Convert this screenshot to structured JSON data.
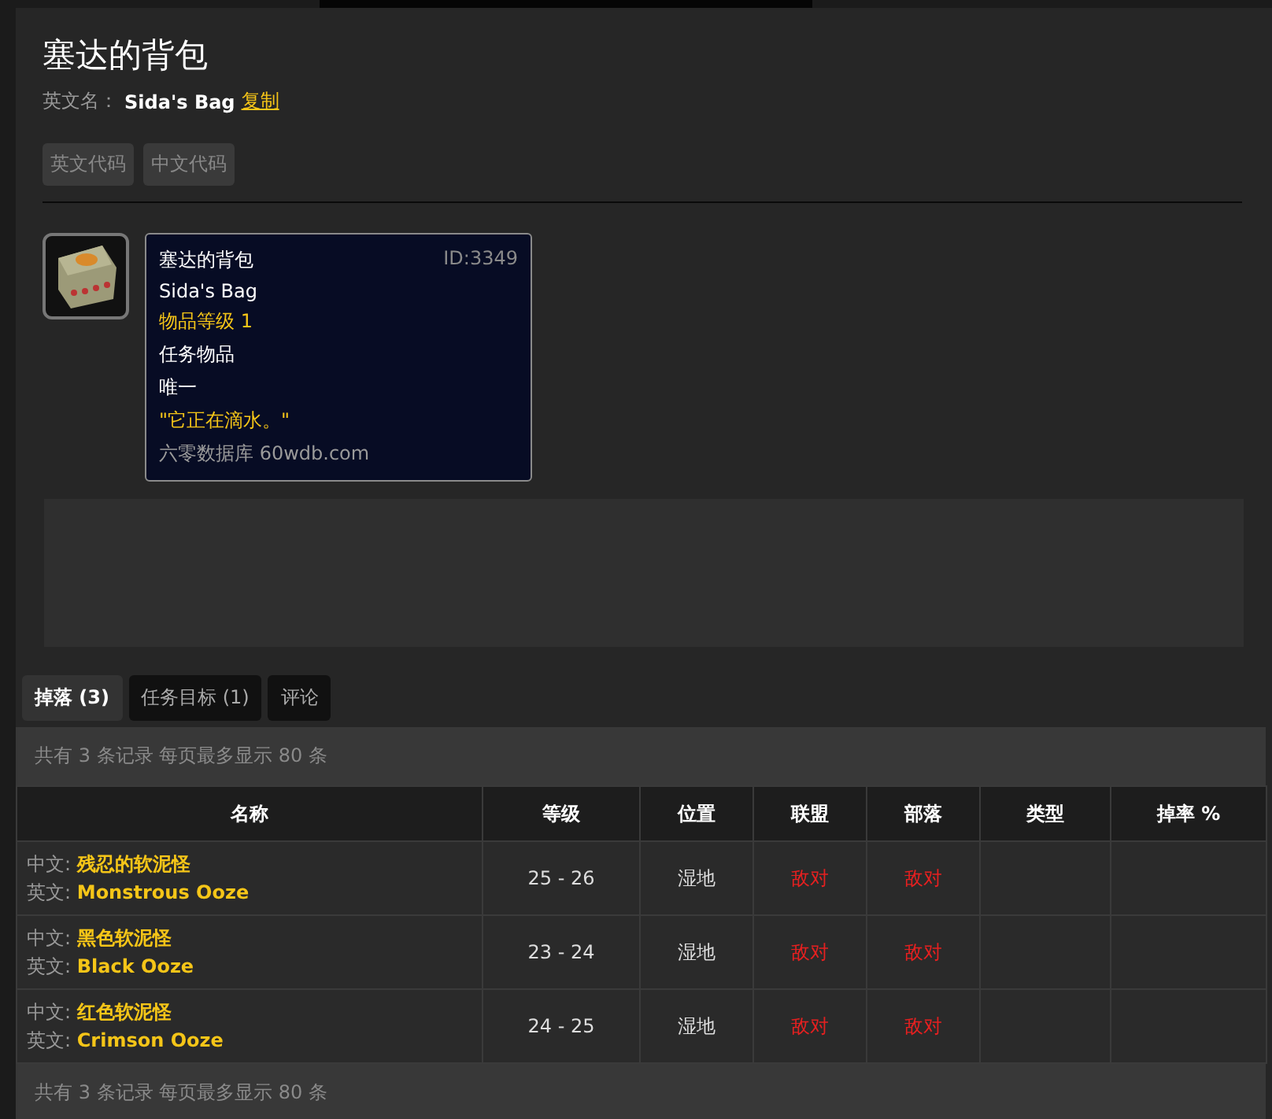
{
  "title": "塞达的背包",
  "english_name": {
    "label": "英文名：",
    "value": "Sida's Bag",
    "copy_link": "复制"
  },
  "code_buttons": [
    "英文代码",
    "中文代码"
  ],
  "tooltip": {
    "name": "塞达的背包",
    "id": "ID:3349",
    "lines": [
      {
        "text": "Sida's Bag",
        "kind": "plain"
      },
      {
        "text": "物品等级 1",
        "kind": "gold"
      },
      {
        "text": "任务物品",
        "kind": "plain"
      },
      {
        "text": "唯一",
        "kind": "plain"
      },
      {
        "text": "\"它正在滴水。\"",
        "kind": "gold"
      },
      {
        "text": "六零数据库 60wdb.com",
        "kind": "muted"
      }
    ]
  },
  "tabs": [
    {
      "label": "掉落 (3)",
      "selected": true
    },
    {
      "label": "任务目标 (1)",
      "selected": false
    },
    {
      "label": "评论",
      "selected": false
    }
  ],
  "summary_top": "共有 3 条记录 每页最多显示 80 条",
  "table": {
    "columns": [
      "名称",
      "等级",
      "位置",
      "联盟",
      "部落",
      "类型",
      "掉率 %"
    ],
    "rows": [
      {
        "cn_label": "中文:",
        "cn_name": "残忍的软泥怪",
        "en_label": "英文:",
        "en_name": "Monstrous Ooze",
        "level": "25 - 26",
        "location": "湿地",
        "alliance": "敌对",
        "horde": "敌对"
      },
      {
        "cn_label": "中文:",
        "cn_name": "黑色软泥怪",
        "en_label": "英文:",
        "en_name": "Black Ooze",
        "level": "23 - 24",
        "location": "湿地",
        "alliance": "敌对",
        "horde": "敌对"
      },
      {
        "cn_label": "中文:",
        "cn_name": "红色软泥怪",
        "en_label": "英文:",
        "en_name": "Crimson Ooze",
        "level": "24 - 25",
        "location": "湿地",
        "alliance": "敌对",
        "horde": "敌对"
      }
    ]
  },
  "summary_bottom": "共有 3 条记录 每页最多显示 80 条"
}
